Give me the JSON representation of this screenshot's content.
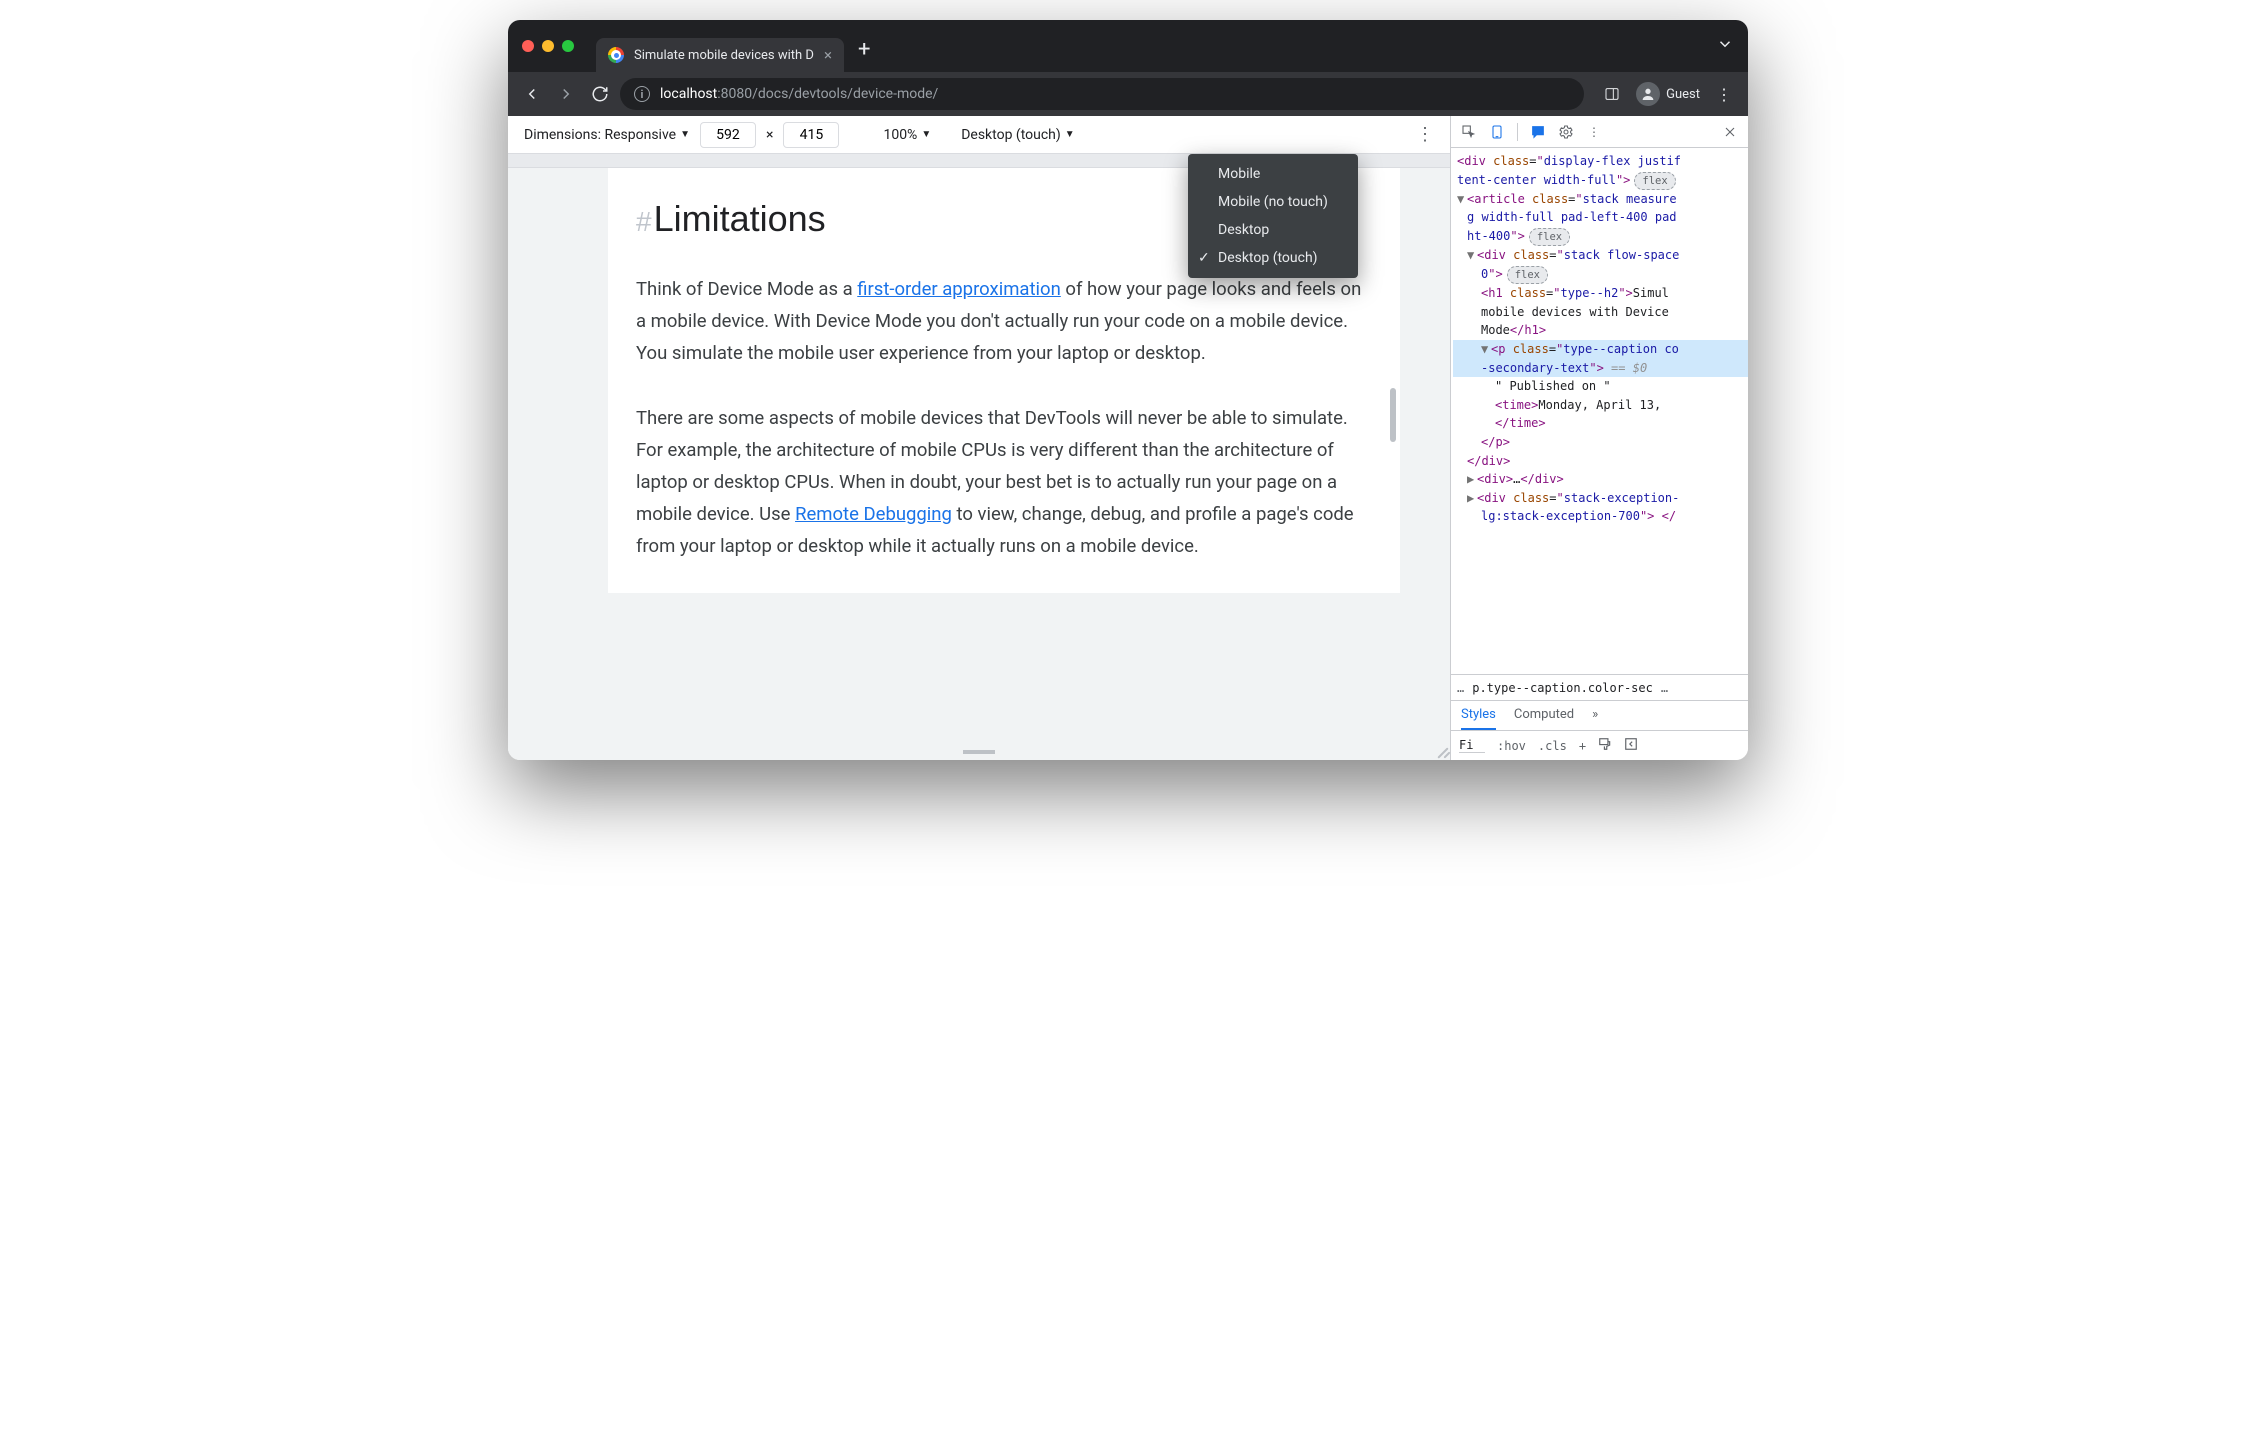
{
  "tab": {
    "title": "Simulate mobile devices with D"
  },
  "address": {
    "host": "localhost",
    "port": ":8080",
    "path": "/docs/devtools/device-mode/",
    "guest_label": "Guest"
  },
  "device_toolbar": {
    "dimensions_label": "Dimensions: Responsive",
    "width": "592",
    "height": "415",
    "separator": "×",
    "zoom": "100%",
    "device_type": "Desktop (touch)"
  },
  "device_type_menu": {
    "items": [
      "Mobile",
      "Mobile (no touch)",
      "Desktop",
      "Desktop (touch)"
    ],
    "selected": "Desktop (touch)"
  },
  "page": {
    "hash": "#",
    "heading": "Limitations",
    "p1_a": "Think of Device Mode as a ",
    "p1_link1": "first-order approximation",
    "p1_b": " of how your page looks and feels on a mobile device. With Device Mode you don't actually run your code on a mobile device. You simulate the mobile user experience from your laptop or desktop.",
    "p2_a": "There are some aspects of mobile devices that DevTools will never be able to simulate. For example, the architecture of mobile CPUs is very different than the architecture of laptop or desktop CPUs. When in doubt, your best bet is to actually run your page on a mobile device. Use ",
    "p2_link1": "Remote Debugging",
    "p2_b": " to view, change, debug, and profile a page's code from your laptop or desktop while it actually runs on a mobile device."
  },
  "elements": {
    "l1": "div",
    "l1_attr": "display-flex justif",
    "l1_cont": "tent-center width-full",
    "flex": "flex",
    "l2": "article",
    "l2_attr": "stack measure-g width-full pad-left-400 pad-ht-400",
    "l3": "div",
    "l3_attr": "stack flow-space-0",
    "l4": "h1",
    "l4_attr": "type--h2",
    "l4_text": "Simulate mobile devices with Device Mode",
    "l5": "p",
    "l5_attr": "type--caption color--secondary-text",
    "l5_var": " == $0",
    "l5_text": "\" Published on \"",
    "l6": "time",
    "l6_text": "Monday, April 13,",
    "l7": "div",
    "l7_ellipsis": "…",
    "l8": "div",
    "l8_attr": "stack-exception-lg:stack-exception-700"
  },
  "crumbs": {
    "ellipsis": "…",
    "path": "p.type--caption.color-sec",
    "more": "…"
  },
  "styles": {
    "tab1": "Styles",
    "tab2": "Computed",
    "more": "»",
    "filter": "Fi",
    "hov": ":hov",
    "cls": ".cls"
  }
}
